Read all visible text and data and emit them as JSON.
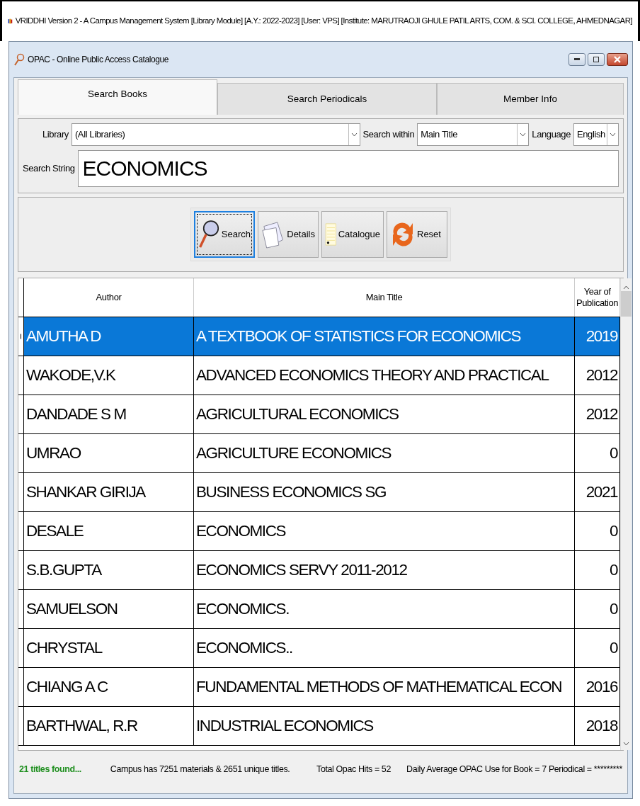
{
  "app_title": "VRIDDHI Version 2 - A Campus Management System [Library Module] [A.Y.: 2022-2023] [User: VPS] [Institute: MARUTRAOJI GHULE PATIL ARTS, COM. & SCI. COLLEGE, AHMEDNAGAR]",
  "window": {
    "title": "OPAC - Online Public Access Catalogue"
  },
  "tabs": [
    {
      "label": "Search Books",
      "selected": true
    },
    {
      "label": "Search Periodicals",
      "selected": false
    },
    {
      "label": "Member Info",
      "selected": false
    }
  ],
  "filters": {
    "library_label": "Library",
    "library_value": "(All Libraries)",
    "search_within_label": "Search within",
    "search_within_value": "Main Title",
    "language_label": "Language",
    "language_value": "English",
    "search_string_label": "Search String",
    "search_string_value": "ECONOMICS"
  },
  "buttons": [
    {
      "label": "Search",
      "kind": "search",
      "focused": true
    },
    {
      "label": "Details",
      "kind": "details",
      "focused": false
    },
    {
      "label": "Catalogue",
      "kind": "catalogue",
      "focused": false
    },
    {
      "label": "Reset",
      "kind": "reset",
      "focused": false
    }
  ],
  "table": {
    "columns": [
      "Author",
      "Main Title",
      "Year of Publication"
    ],
    "rows": [
      {
        "author": "AMUTHA D",
        "title": "A TEXTBOOK OF STATISTICS FOR ECONOMICS",
        "year": "2019",
        "selected": true
      },
      {
        "author": "WAKODE,V.K",
        "title": "ADVANCED ECONOMICS THEORY AND PRACTICAL",
        "year": "2012",
        "selected": false
      },
      {
        "author": "DANDADE S M",
        "title": "AGRICULTURAL ECONOMICS",
        "year": "2012",
        "selected": false
      },
      {
        "author": "UMRAO",
        "title": "AGRICULTURE ECONOMICS",
        "year": "0",
        "selected": false
      },
      {
        "author": "SHANKAR GIRIJA",
        "title": "BUSINESS ECONOMICS SG",
        "year": "2021",
        "selected": false
      },
      {
        "author": "DESALE",
        "title": "ECONOMICS",
        "year": "0",
        "selected": false
      },
      {
        "author": "S.B.GUPTA",
        "title": "ECONOMICS SERVY 2011-2012",
        "year": "0",
        "selected": false
      },
      {
        "author": "SAMUELSON",
        "title": "ECONOMICS.",
        "year": "0",
        "selected": false
      },
      {
        "author": "CHRYSTAL",
        "title": "ECONOMICS..",
        "year": "0",
        "selected": false
      },
      {
        "author": "CHIANG A C",
        "title": "FUNDAMENTAL METHODS OF MATHEMATICAL ECON",
        "year": "2016",
        "selected": false
      },
      {
        "author": "BARTHWAL, R.R",
        "title": "INDUSTRIAL ECONOMICS",
        "year": "2018",
        "selected": false
      }
    ]
  },
  "status_bar": [
    "21 titles found...",
    "Campus has 7251 materials & 2651 unique titles.",
    "Total Opac Hits = 52",
    "Daily Average OPAC Use for Book = 7 Periodical = *********"
  ]
}
